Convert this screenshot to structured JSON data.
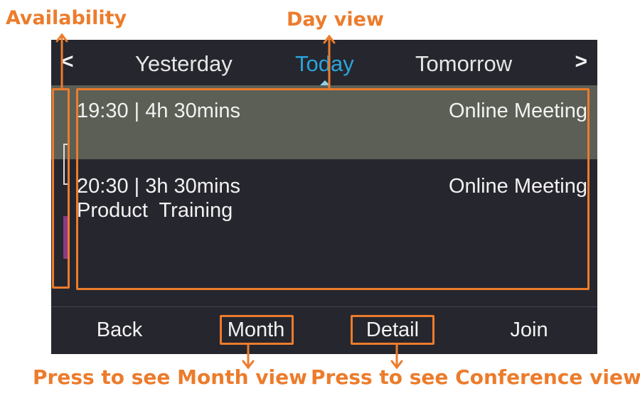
{
  "annotations": {
    "availability": "Availability",
    "day_view": "Day view",
    "month_hint": "Press to see Month view",
    "conference_hint": "Press to see Conference view"
  },
  "nav": {
    "prev_icon": "chevron-left-icon",
    "next_icon": "chevron-right-icon",
    "prev_glyph": "<",
    "next_glyph": ">",
    "tabs": [
      {
        "label": "Yesterday",
        "selected": false
      },
      {
        "label": "Today",
        "selected": true
      },
      {
        "label": "Tomorrow",
        "selected": false
      }
    ]
  },
  "events": [
    {
      "time": "19:30 | 4h 30mins",
      "type": "Online Meeting",
      "title": "",
      "selected": true,
      "availability": "free"
    },
    {
      "time": "20:30 | 3h 30mins",
      "type": "Online Meeting",
      "title": "Product  Training",
      "selected": false,
      "availability": "busy"
    }
  ],
  "softkeys": {
    "back": "Back",
    "month": "Month",
    "detail": "Detail",
    "join": "Join"
  },
  "colors": {
    "annotation": "#ec7c2c",
    "screen_bg": "#26262e",
    "selected_row": "#5c5f55",
    "accent_today": "#2aa4dc",
    "busy_indicator": "#8b3a86"
  }
}
